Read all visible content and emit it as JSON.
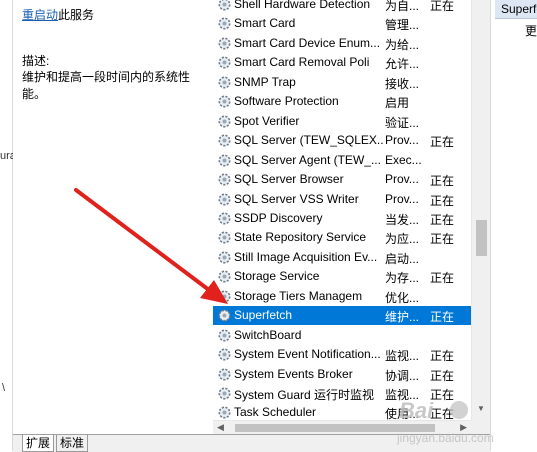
{
  "left_strip": {
    "fragment": "ura",
    "fragment2": "\\"
  },
  "details": {
    "restart_link": "重启动",
    "restart_suffix": "此服务",
    "desc_label": "描述:",
    "desc_text": "维护和提高一段时间内的系统性能。"
  },
  "services": [
    {
      "name": "Shell Hardware Detection",
      "desc": "为自...",
      "status": "正在"
    },
    {
      "name": "Smart Card",
      "desc": "管理...",
      "status": ""
    },
    {
      "name": "Smart Card Device Enum...",
      "desc": "为给...",
      "status": ""
    },
    {
      "name": "Smart Card Removal Poli",
      "desc": "允许...",
      "status": ""
    },
    {
      "name": "SNMP Trap",
      "desc": "接收...",
      "status": ""
    },
    {
      "name": "Software Protection",
      "desc": "启用",
      "status": ""
    },
    {
      "name": "Spot Verifier",
      "desc": "验证...",
      "status": ""
    },
    {
      "name": "SQL Server (TEW_SQLEX...",
      "desc": "Prov...",
      "status": "正在"
    },
    {
      "name": "SQL Server Agent (TEW_...",
      "desc": "Exec...",
      "status": ""
    },
    {
      "name": "SQL Server Browser",
      "desc": "Prov...",
      "status": "正在"
    },
    {
      "name": "SQL Server VSS Writer",
      "desc": "Prov...",
      "status": "正在"
    },
    {
      "name": "SSDP Discovery",
      "desc": "当发...",
      "status": "正在"
    },
    {
      "name": "State Repository Service",
      "desc": "为应...",
      "status": "正在"
    },
    {
      "name": "Still Image Acquisition Ev...",
      "desc": "启动...",
      "status": ""
    },
    {
      "name": "Storage Service",
      "desc": "为存...",
      "status": "正在"
    },
    {
      "name": "Storage Tiers Managem",
      "desc": "优化...",
      "status": ""
    },
    {
      "name": "Superfetch",
      "desc": "维护...",
      "status": "正在",
      "selected": true
    },
    {
      "name": "SwitchBoard",
      "desc": "",
      "status": ""
    },
    {
      "name": "System Event Notification...",
      "desc": "监视...",
      "status": "正在"
    },
    {
      "name": "System Events Broker",
      "desc": "协调...",
      "status": "正在"
    },
    {
      "name": "System Guard 运行时监视",
      "desc": "监视...",
      "status": "正在"
    },
    {
      "name": "Task Scheduler",
      "desc": "使用...",
      "status": "正在"
    }
  ],
  "actions": {
    "header": "Superfetch",
    "more": "更多"
  },
  "tabs": {
    "extended": "扩展",
    "standard": "标准"
  },
  "colors": {
    "selection": "#0078d7",
    "arrow": "#e0211c",
    "link": "#1a5fb4"
  },
  "watermark": {
    "brand": "Bai",
    "site": "jingyan.baidu.com"
  }
}
